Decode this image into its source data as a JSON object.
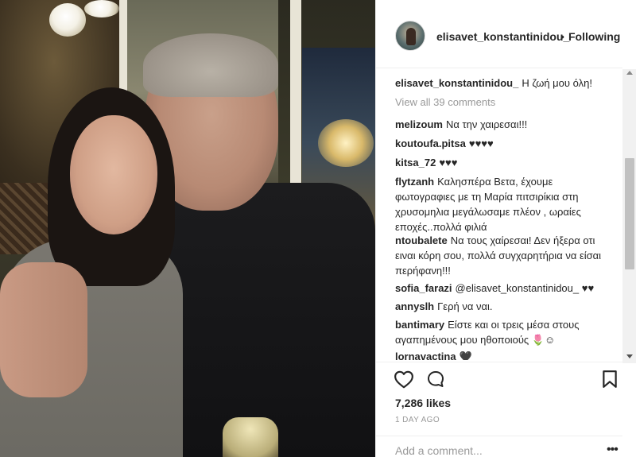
{
  "post": {
    "author": "elisavet_konstantinidou_",
    "follow_dot": "•",
    "follow_status": "Following"
  },
  "caption": {
    "user": "elisavet_konstantinidou_",
    "text": "Η ζωή μου όλη!"
  },
  "view_all_comments": "View all 39 comments",
  "comments": [
    {
      "user": "melizoum",
      "text": "Να την χαιρεσαι!!!"
    },
    {
      "user": "koutoufa.pitsa",
      "text": "♥♥♥♥"
    },
    {
      "user": "kitsa_72",
      "text": "♥♥♥"
    },
    {
      "user": "flytzanh",
      "text": "Καλησπέρα Βετα, έχουμε φωτογραφιες με τη Μαρία πιτσιρίκια στη χρυσομηλια μεγάλωσαμε πλέον , ωραίες εποχές..πολλά φιλιά"
    },
    {
      "user": "ntoubalete",
      "text": "Να τους χαίρεσαι! Δεν ήξερα οτι ειναι κόρη σου, πολλά συγχαρητήρια να είσαι περήφανη!!!"
    },
    {
      "user": "sofia_farazi",
      "text": "@elisavet_konstantinidou_ ♥♥"
    },
    {
      "user": "annyslh",
      "text": "Γερή να ναι."
    },
    {
      "user": "bantimary",
      "text": "Είστε και οι τρεις μέσα στους αγαπημένους μου ηθοποιούς 🌷☺"
    },
    {
      "user": "lornavactina",
      "text": "🖤"
    }
  ],
  "actions": {
    "likes": "7,286 likes",
    "time_ago": "1 DAY AGO",
    "add_comment_placeholder": "Add a comment...",
    "more_label": "•••"
  },
  "icons": {
    "like": "heart-outline-icon",
    "comment": "speech-bubble-icon",
    "save": "bookmark-outline-icon"
  }
}
